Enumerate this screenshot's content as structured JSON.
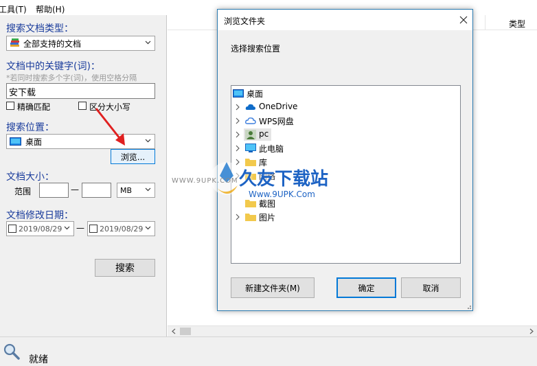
{
  "menu": {
    "tools": "工具(T)",
    "help": "帮助(H)"
  },
  "left": {
    "doc_type_label": "搜索文档类型：",
    "doc_type_value": "全部支持的文档",
    "keyword_label": "文档中的关键字(词)：",
    "keyword_hint": "*若同时搜索多个字(词)，使用空格分隔",
    "keyword_value": "安下载",
    "exact_match": "精确匹配",
    "case_sensitive": "区分大小写",
    "location_label": "搜索位置：",
    "location_value": "桌面",
    "browse_button": "浏览...",
    "size_label": "文档大小：",
    "range_label": "范围",
    "range_dash": "—",
    "size_unit": "MB",
    "date_label": "文档修改日期：",
    "date_from": "2019/08/29",
    "date_to": "2019/08/29",
    "date_dash": "—",
    "search_button": "搜索"
  },
  "results": {
    "type_column": "类型"
  },
  "status": {
    "text": "就绪"
  },
  "dialog": {
    "title": "浏览文件夹",
    "prompt": "选择搜索位置",
    "tree": [
      {
        "label": "桌面",
        "icon": "desktop-icon",
        "has_chevron": false
      },
      {
        "label": "OneDrive",
        "icon": "cloud-icon",
        "has_chevron": true
      },
      {
        "label": "WPS网盘",
        "icon": "cloud-outline-icon",
        "has_chevron": true
      },
      {
        "label": "pc",
        "icon": "user-icon",
        "has_chevron": true
      },
      {
        "label": "此电脑",
        "icon": "computer-icon",
        "has_chevron": true
      },
      {
        "label": "库",
        "icon": "folder-icon",
        "has_chevron": true
      },
      {
        "label": "网络",
        "icon": "folder-icon",
        "has_chevron": true
      },
      {
        "label": "截图",
        "icon": "folder-icon",
        "has_chevron": false
      },
      {
        "label": "图片",
        "icon": "folder-icon",
        "has_chevron": true
      }
    ],
    "new_folder_button": "新建文件夹(M)",
    "ok_button": "确定",
    "cancel_button": "取消"
  },
  "watermark": {
    "brand": "久友下载站",
    "url_left": "WWW.9UPK.COM",
    "url_right": "Www.9UPK.Com"
  },
  "colors": {
    "label_blue": "#1a3c9c",
    "dialog_border": "#2a7ab0",
    "ok_border": "#0078d7",
    "arrow_red": "#e02020"
  }
}
